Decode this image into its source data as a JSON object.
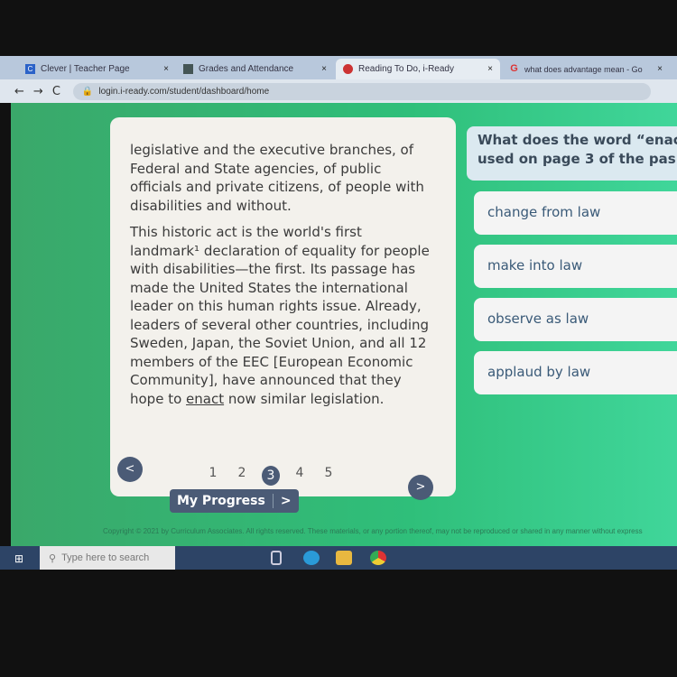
{
  "browser": {
    "tabs": [
      {
        "title": "Clever | Teacher Page",
        "icon": "clever-icon"
      },
      {
        "title": "Grades and Attendance",
        "icon": "grades-icon"
      },
      {
        "title": "Reading To Do, i-Ready",
        "icon": "iready-icon",
        "active": true
      },
      {
        "title": "what does advantage mean - Go",
        "icon": "google-icon"
      }
    ],
    "close": "×",
    "url": "login.i-ready.com/student/dashboard/home"
  },
  "passage": {
    "p1": "legislative and the executive branches, of Federal and State agencies, of public officials and private citizens, of people with disabilities and without.",
    "p2_before": "This historic act is the world's first landmark¹ declaration of equality for people with disabilities—the first. Its passage has made the United States the international leader on this human rights issue. Already, leaders of several other countries, including Sweden, Japan, the Soviet Union, and all 12 members of the EEC [European Economic Community], have announced that they hope to ",
    "p2_link": "enact",
    "p2_after": " now similar legislation."
  },
  "pagination": {
    "prev": "<",
    "next": ">",
    "pages": [
      "1",
      "2",
      "3",
      "4",
      "5"
    ],
    "current": "3"
  },
  "my_progress": {
    "label": "My Progress",
    "arrow": ">"
  },
  "question": {
    "line1": "What does the word “enac",
    "line2": "used on page 3 of the pas"
  },
  "answers": [
    "change from law",
    "make into law",
    "observe as law",
    "applaud by law"
  ],
  "footer": {
    "copyright": "Copyright © 2021 by Curriculum Associates. All rights reserved. These materials, or any portion thereof, may not be reproduced or shared in any manner without express"
  },
  "taskbar": {
    "search_placeholder": "Type here to search"
  }
}
